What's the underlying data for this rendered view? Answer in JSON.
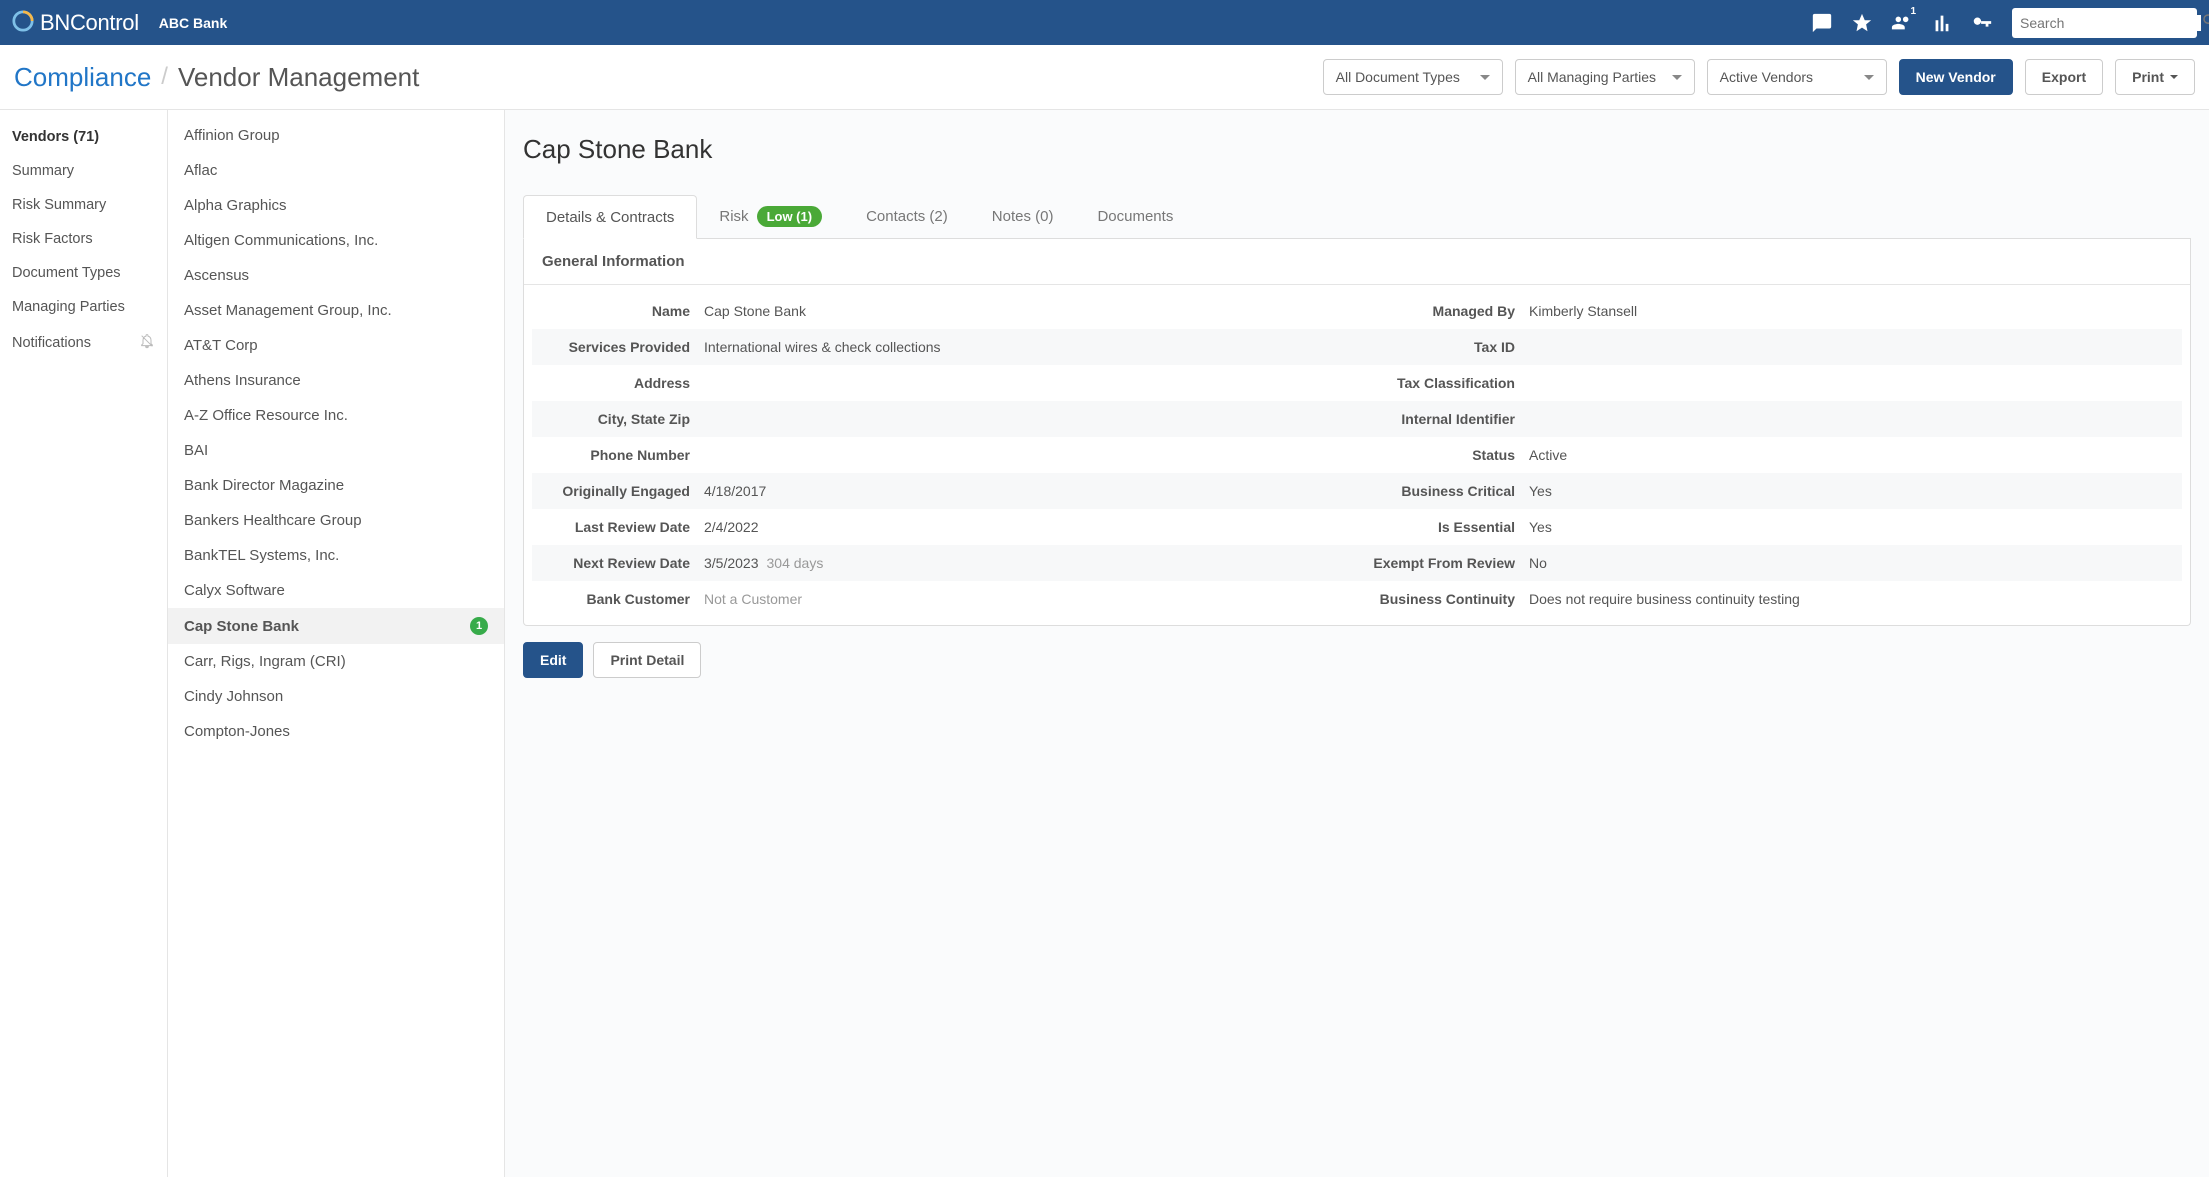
{
  "topbar": {
    "brand_prefix": "BN",
    "brand_suffix": "Control",
    "client": "ABC Bank",
    "user_badge": "1",
    "search_placeholder": "Search"
  },
  "breadcrumb": {
    "parent": "Compliance",
    "page": "Vendor Management"
  },
  "filters": {
    "document_types": "All Document Types",
    "managing_parties": "All Managing Parties",
    "vendor_status": "Active Vendors"
  },
  "buttons": {
    "new_vendor": "New Vendor",
    "export": "Export",
    "print": "Print",
    "edit": "Edit",
    "print_detail": "Print Detail"
  },
  "sidebar": {
    "items": [
      {
        "label": "Vendors (71)"
      },
      {
        "label": "Summary"
      },
      {
        "label": "Risk Summary"
      },
      {
        "label": "Risk Factors"
      },
      {
        "label": "Document Types"
      },
      {
        "label": "Managing Parties"
      },
      {
        "label": "Notifications"
      }
    ]
  },
  "vendor_list": [
    {
      "name": "Affinion Group"
    },
    {
      "name": "Aflac"
    },
    {
      "name": "Alpha Graphics"
    },
    {
      "name": "Altigen Communications, Inc."
    },
    {
      "name": "Ascensus"
    },
    {
      "name": "Asset Management Group, Inc."
    },
    {
      "name": "AT&T Corp"
    },
    {
      "name": "Athens Insurance"
    },
    {
      "name": "A-Z Office Resource Inc."
    },
    {
      "name": "BAI"
    },
    {
      "name": "Bank Director Magazine"
    },
    {
      "name": "Bankers Healthcare Group"
    },
    {
      "name": "BankTEL Systems, Inc."
    },
    {
      "name": "Calyx Software"
    },
    {
      "name": "Cap Stone Bank",
      "selected": true,
      "badge": "1"
    },
    {
      "name": "Carr, Rigs, Ingram (CRI)"
    },
    {
      "name": "Cindy Johnson"
    },
    {
      "name": "Compton-Jones"
    }
  ],
  "detail": {
    "title": "Cap Stone Bank",
    "tabs": {
      "details": "Details & Contracts",
      "risk": "Risk",
      "risk_badge": "Low (1)",
      "contacts": "Contacts (2)",
      "notes": "Notes (0)",
      "documents": "Documents"
    },
    "panel_title": "General Information",
    "fields": {
      "name_label": "Name",
      "name_value": "Cap Stone Bank",
      "managed_by_label": "Managed By",
      "managed_by_value": "Kimberly Stansell",
      "services_label": "Services Provided",
      "services_value": "International wires & check collections",
      "tax_id_label": "Tax ID",
      "tax_id_value": "",
      "address_label": "Address",
      "address_value": "",
      "tax_class_label": "Tax Classification",
      "tax_class_value": "",
      "csz_label": "City, State Zip",
      "csz_value": "",
      "internal_id_label": "Internal Identifier",
      "internal_id_value": "",
      "phone_label": "Phone Number",
      "phone_value": "",
      "status_label": "Status",
      "status_value": "Active",
      "engaged_label": "Originally Engaged",
      "engaged_value": "4/18/2017",
      "critical_label": "Business Critical",
      "critical_value": "Yes",
      "last_review_label": "Last Review Date",
      "last_review_value": "2/4/2022",
      "essential_label": "Is Essential",
      "essential_value": "Yes",
      "next_review_label": "Next Review Date",
      "next_review_value": "3/5/2023",
      "next_review_days": "304 days",
      "exempt_label": "Exempt From Review",
      "exempt_value": "No",
      "bank_customer_label": "Bank Customer",
      "bank_customer_value": "Not a Customer",
      "continuity_label": "Business Continuity",
      "continuity_value": "Does not require business continuity testing"
    }
  }
}
